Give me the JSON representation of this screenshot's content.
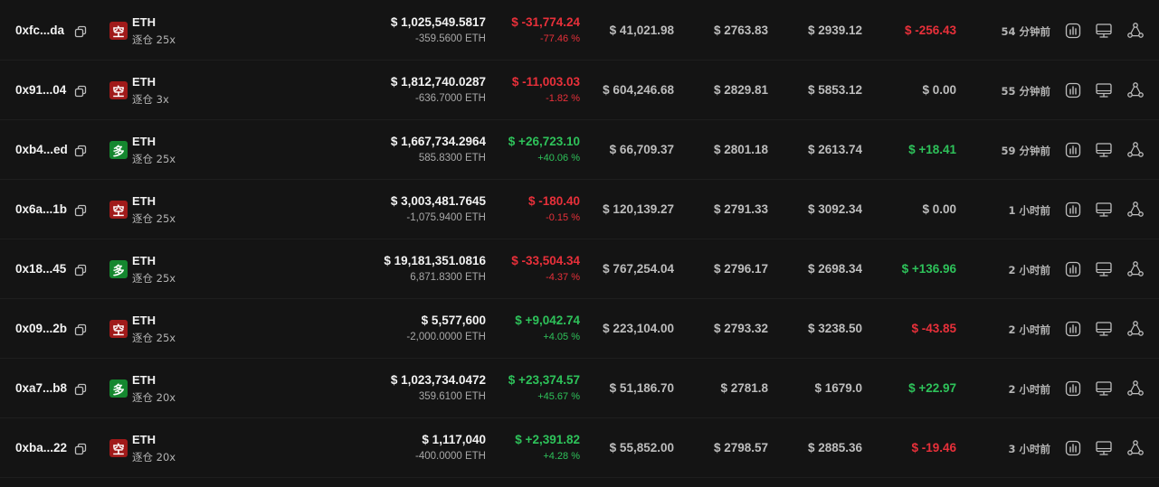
{
  "colors": {
    "background": "#141414",
    "negative": "#e8303a",
    "positive": "#2ec25a",
    "short_badge": "#a01a1a",
    "long_badge": "#15872f"
  },
  "icons": {
    "copy": "copy-icon",
    "chart": "chart-icon",
    "monitor": "monitor-icon",
    "share": "share-icon"
  },
  "rows": [
    {
      "address": "0xfc...da",
      "side": "空",
      "side_type": "short",
      "symbol": "ETH",
      "leverage": "逐仓 25x",
      "value": "$ 1,025,549.5817",
      "size": "-359.5600 ETH",
      "pnl": "$ -31,774.24",
      "pnl_pct": "-77.46 %",
      "pnl_tone": "neg",
      "margin": "$ 41,021.98",
      "entry": "$ 2763.83",
      "liq": "$ 2939.12",
      "funding": "$ -256.43",
      "funding_tone": "neg",
      "time": "54 分钟前"
    },
    {
      "address": "0x91...04",
      "side": "空",
      "side_type": "short",
      "symbol": "ETH",
      "leverage": "逐仓 3x",
      "value": "$ 1,812,740.0287",
      "size": "-636.7000 ETH",
      "pnl": "$ -11,003.03",
      "pnl_pct": "-1.82 %",
      "pnl_tone": "neg",
      "margin": "$ 604,246.68",
      "entry": "$ 2829.81",
      "liq": "$ 5853.12",
      "funding": "$ 0.00",
      "funding_tone": "neu",
      "time": "55 分钟前"
    },
    {
      "address": "0xb4...ed",
      "side": "多",
      "side_type": "long",
      "symbol": "ETH",
      "leverage": "逐仓 25x",
      "value": "$ 1,667,734.2964",
      "size": "585.8300 ETH",
      "pnl": "$ +26,723.10",
      "pnl_pct": "+40.06 %",
      "pnl_tone": "pos",
      "margin": "$ 66,709.37",
      "entry": "$ 2801.18",
      "liq": "$ 2613.74",
      "funding": "$ +18.41",
      "funding_tone": "pos",
      "time": "59 分钟前"
    },
    {
      "address": "0x6a...1b",
      "side": "空",
      "side_type": "short",
      "symbol": "ETH",
      "leverage": "逐仓 25x",
      "value": "$ 3,003,481.7645",
      "size": "-1,075.9400 ETH",
      "pnl": "$ -180.40",
      "pnl_pct": "-0.15 %",
      "pnl_tone": "neg",
      "margin": "$ 120,139.27",
      "entry": "$ 2791.33",
      "liq": "$ 3092.34",
      "funding": "$ 0.00",
      "funding_tone": "neu",
      "time": "1 小时前"
    },
    {
      "address": "0x18...45",
      "side": "多",
      "side_type": "long",
      "symbol": "ETH",
      "leverage": "逐仓 25x",
      "value": "$ 19,181,351.0816",
      "size": "6,871.8300 ETH",
      "pnl": "$ -33,504.34",
      "pnl_pct": "-4.37 %",
      "pnl_tone": "neg",
      "margin": "$ 767,254.04",
      "entry": "$ 2796.17",
      "liq": "$ 2698.34",
      "funding": "$ +136.96",
      "funding_tone": "pos",
      "time": "2 小时前"
    },
    {
      "address": "0x09...2b",
      "side": "空",
      "side_type": "short",
      "symbol": "ETH",
      "leverage": "逐仓 25x",
      "value": "$ 5,577,600",
      "size": "-2,000.0000 ETH",
      "pnl": "$ +9,042.74",
      "pnl_pct": "+4.05 %",
      "pnl_tone": "pos",
      "margin": "$ 223,104.00",
      "entry": "$ 2793.32",
      "liq": "$ 3238.50",
      "funding": "$ -43.85",
      "funding_tone": "neg",
      "time": "2 小时前"
    },
    {
      "address": "0xa7...b8",
      "side": "多",
      "side_type": "long",
      "symbol": "ETH",
      "leverage": "逐仓 20x",
      "value": "$ 1,023,734.0472",
      "size": "359.6100 ETH",
      "pnl": "$ +23,374.57",
      "pnl_pct": "+45.67 %",
      "pnl_tone": "pos",
      "margin": "$ 51,186.70",
      "entry": "$ 2781.8",
      "liq": "$ 1679.0",
      "funding": "$ +22.97",
      "funding_tone": "pos",
      "time": "2 小时前"
    },
    {
      "address": "0xba...22",
      "side": "空",
      "side_type": "short",
      "symbol": "ETH",
      "leverage": "逐仓 20x",
      "value": "$ 1,117,040",
      "size": "-400.0000 ETH",
      "pnl": "$ +2,391.82",
      "pnl_pct": "+4.28 %",
      "pnl_tone": "pos",
      "margin": "$ 55,852.00",
      "entry": "$ 2798.57",
      "liq": "$ 2885.36",
      "funding": "$ -19.46",
      "funding_tone": "neg",
      "time": "3 小时前"
    }
  ]
}
